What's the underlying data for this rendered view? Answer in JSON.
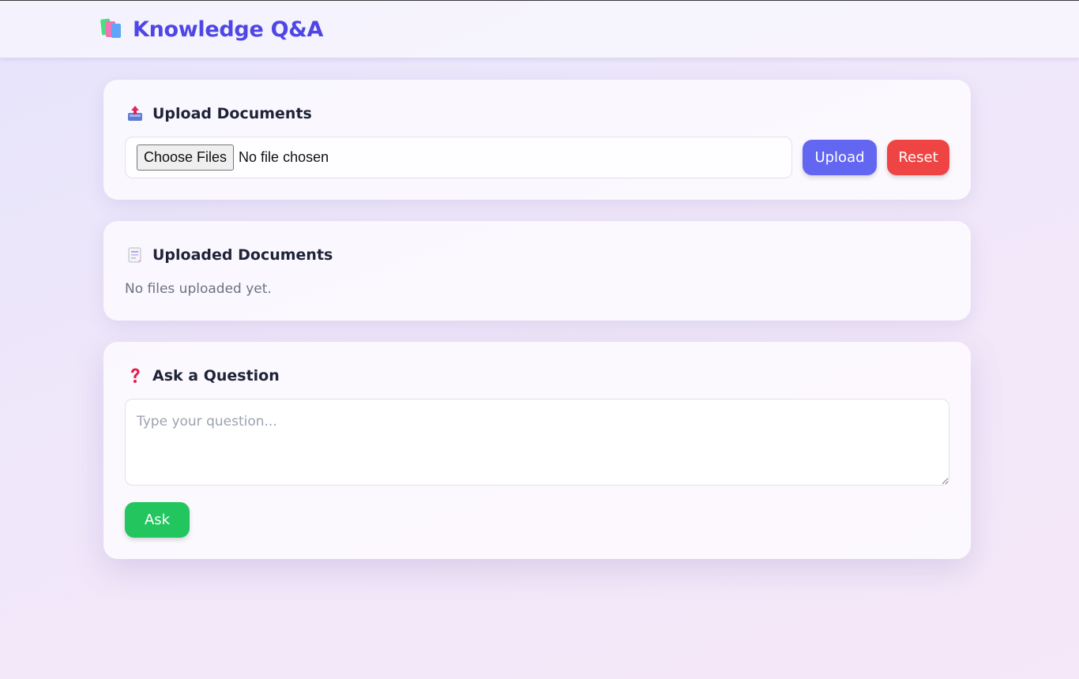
{
  "header": {
    "title": "Knowledge Q&A",
    "icon": "books-icon"
  },
  "upload": {
    "heading": "Upload Documents",
    "icon": "outbox-tray-icon",
    "choose_label": "Choose Files",
    "file_status": "No file chosen",
    "upload_label": "Upload",
    "reset_label": "Reset"
  },
  "documents": {
    "heading": "Uploaded Documents",
    "icon": "document-icon",
    "empty_message": "No files uploaded yet."
  },
  "ask": {
    "heading": "Ask a Question",
    "icon": "question-mark-icon",
    "placeholder": "Type your question...",
    "ask_label": "Ask"
  },
  "colors": {
    "brand": "#4f46e5",
    "upload_button": "#6366f1",
    "reset_button": "#ef4444",
    "ask_button": "#22c55e"
  }
}
